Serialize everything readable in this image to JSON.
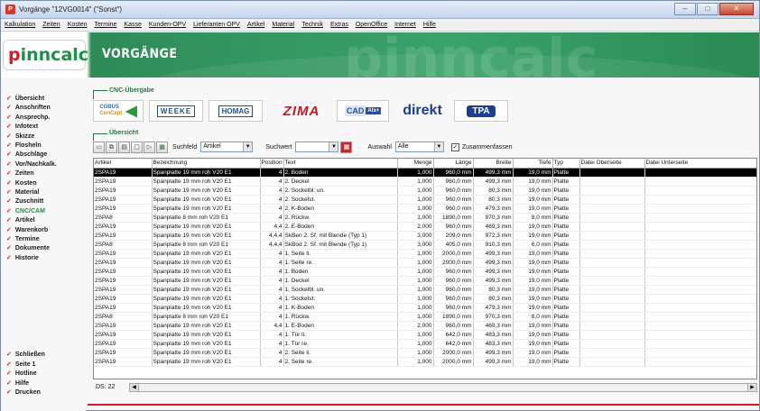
{
  "window": {
    "title": "Vorgänge \"12VG0014\" (\"Sonst\")"
  },
  "menu": [
    "Kalkulation",
    "Zeiten",
    "Kosten",
    "Termine",
    "Kasse",
    "Kunden-OPV",
    "Lieferanten OPV",
    "Artikel",
    "Material",
    "Technik",
    "Extras",
    "OpenOffice",
    "Internet",
    "Hilfe"
  ],
  "banner": {
    "logo": "pinncalc",
    "page_title": "VORGÄNGE",
    "watermark": "pinncalc"
  },
  "sidebar": {
    "items": [
      "Übersicht",
      "Anschriften",
      "Ansprechp.",
      "Infotext",
      "Skizze",
      "Flosheln",
      "Abschläge",
      "Vor/Nachkalk.",
      "Zeiten",
      "Kosten",
      "Material",
      "Zuschnitt",
      "CNC/CAM",
      "Artikel",
      "Warenkorb",
      "Termine",
      "Dokumente",
      "Historie"
    ],
    "active": "CNC/CAM",
    "bottom_items": [
      "Schließen",
      "Seite 1",
      "Hotline",
      "Hilfe",
      "Drucken"
    ]
  },
  "cnc": {
    "header": "CNC-Übergabe",
    "logos": [
      "COBUS ConCept",
      "WEEKE",
      "HOMAG",
      "IMA",
      "CAD+T",
      "direkt",
      "TPA"
    ]
  },
  "overview": {
    "header": "Übersicht",
    "suchfeld_label": "Suchfeld",
    "suchfeld_value": "Artikel",
    "suchwert_label": "Suchwert",
    "suchwert_value": "",
    "auswahl_label": "Auswahl",
    "auswahl_value": "Alle",
    "zusammenfassen_label": "Zusammenfassen",
    "zusammenfassen_checked": true
  },
  "table": {
    "columns": [
      "Artikel",
      "Bezeichnung",
      "Position",
      "Text",
      "Menge",
      "Länge",
      "Breite",
      "Tiefe",
      "Typ",
      "Datei Oberseite",
      "Datei Unterseite"
    ],
    "rows": [
      [
        "2SPA19",
        "Spanplatte 19 mm roh V20 E1",
        "4",
        "2. Boden",
        "1,000",
        "960,0 mm",
        "499,3 mm",
        "19,0 mm",
        "Platte",
        "",
        ""
      ],
      [
        "2SPA19",
        "Spanplatte 19 mm roh V20 E1",
        "4",
        "2. Deckel",
        "1,000",
        "960,0 mm",
        "499,3 mm",
        "19,0 mm",
        "Platte",
        "",
        ""
      ],
      [
        "2SPA19",
        "Spanplatte 19 mm roh V20 E1",
        "4",
        "2. Sockelbl. un.",
        "1,000",
        "960,0 mm",
        "80,3 mm",
        "19,0 mm",
        "Platte",
        "",
        ""
      ],
      [
        "2SPA19",
        "Spanplatte 19 mm roh V20 E1",
        "4",
        "2. Sockelst.",
        "1,000",
        "960,0 mm",
        "80,3 mm",
        "19,0 mm",
        "Platte",
        "",
        ""
      ],
      [
        "2SPA19",
        "Spanplatte 19 mm roh V20 E1",
        "4",
        "2. K-Boden",
        "1,000",
        "960,0 mm",
        "479,3 mm",
        "19,0 mm",
        "Platte",
        "",
        ""
      ],
      [
        "2SPA8",
        "Spanplatte 8 mm roh V20 E1",
        "4",
        "2. Rückw.",
        "1,000",
        "1890,0 mm",
        "970,3 mm",
        "8,0 mm",
        "Platte",
        "",
        ""
      ],
      [
        "2SPA19",
        "Spanplatte 19 mm roh V20 E1",
        "4,4",
        "2. E-Boden",
        "2,000",
        "960,0 mm",
        "469,3 mm",
        "19,0 mm",
        "Platte",
        "",
        ""
      ],
      [
        "2SPA19",
        "Spanplatte 19 mm roh V20 E1",
        "4,4,4",
        "SkBen 2. Sf. mit Blende (Typ 1)",
        "3,000",
        "209,0 mm",
        "972,3 mm",
        "19,0 mm",
        "Platte",
        "",
        ""
      ],
      [
        "2SPA8",
        "Spanplatte 8 mm roh V20 E1",
        "4,4,4",
        "SkBod 2. Sf. mit Blende (Typ 1)",
        "3,000",
        "405,0 mm",
        "910,3 mm",
        "6,0 mm",
        "Platte",
        "",
        ""
      ],
      [
        "2SPA19",
        "Spanplatte 19 mm roh V20 E1",
        "4",
        "1. Seite li.",
        "1,000",
        "2000,0 mm",
        "499,3 mm",
        "19,0 mm",
        "Platte",
        "",
        ""
      ],
      [
        "2SPA19",
        "Spanplatte 19 mm roh V20 E1",
        "4",
        "1. Seite re.",
        "1,000",
        "2000,0 mm",
        "499,3 mm",
        "19,0 mm",
        "Platte",
        "",
        ""
      ],
      [
        "2SPA19",
        "Spanplatte 19 mm roh V20 E1",
        "4",
        "1. Boden",
        "1,000",
        "960,0 mm",
        "499,3 mm",
        "19,0 mm",
        "Platte",
        "",
        ""
      ],
      [
        "2SPA19",
        "Spanplatte 19 mm roh V20 E1",
        "4",
        "1. Deckel",
        "1,000",
        "960,0 mm",
        "499,3 mm",
        "19,0 mm",
        "Platte",
        "",
        ""
      ],
      [
        "2SPA19",
        "Spanplatte 19 mm roh V20 E1",
        "4",
        "1. Sockelbl. un.",
        "1,000",
        "960,0 mm",
        "80,3 mm",
        "19,0 mm",
        "Platte",
        "",
        ""
      ],
      [
        "2SPA19",
        "Spanplatte 19 mm roh V20 E1",
        "4",
        "1. Sockelst.",
        "1,000",
        "960,0 mm",
        "80,3 mm",
        "19,0 mm",
        "Platte",
        "",
        ""
      ],
      [
        "2SPA19",
        "Spanplatte 19 mm roh V20 E1",
        "4",
        "1. K-Boden",
        "1,000",
        "960,0 mm",
        "479,3 mm",
        "19,0 mm",
        "Platte",
        "",
        ""
      ],
      [
        "2SPA8",
        "Spanplatte 8 mm roh V20 E1",
        "4",
        "1. Rückw.",
        "1,000",
        "1890,0 mm",
        "970,3 mm",
        "8,0 mm",
        "Platte",
        "",
        ""
      ],
      [
        "2SPA19",
        "Spanplatte 19 mm roh V20 E1",
        "4,4",
        "1. E-Boden",
        "2,000",
        "960,0 mm",
        "469,3 mm",
        "19,0 mm",
        "Platte",
        "",
        ""
      ],
      [
        "2SPA19",
        "Spanplatte 19 mm roh V20 E1",
        "4",
        "1. Tür li.",
        "1,000",
        "642,0 mm",
        "483,3 mm",
        "19,0 mm",
        "Platte",
        "",
        ""
      ],
      [
        "2SPA19",
        "Spanplatte 19 mm roh V20 E1",
        "4",
        "1. Tür re.",
        "1,000",
        "642,0 mm",
        "483,3 mm",
        "19,0 mm",
        "Platte",
        "",
        ""
      ],
      [
        "2SPA19",
        "Spanplatte 19 mm roh V20 E1",
        "4",
        "2. Seite li.",
        "1,000",
        "2000,0 mm",
        "499,3 mm",
        "19,0 mm",
        "Platte",
        "",
        ""
      ],
      [
        "2SPA19",
        "Spanplatte 19 mm roh V20 E1",
        "4",
        "2. Seite re.",
        "1,000",
        "2000,0 mm",
        "499,3 mm",
        "19,0 mm",
        "Platte",
        "",
        ""
      ]
    ],
    "selected_row": 0
  },
  "status": {
    "ds": "DS: 22"
  },
  "colors": {
    "brand_green": "#1f8f4a",
    "brand_red": "#d31c2a"
  }
}
